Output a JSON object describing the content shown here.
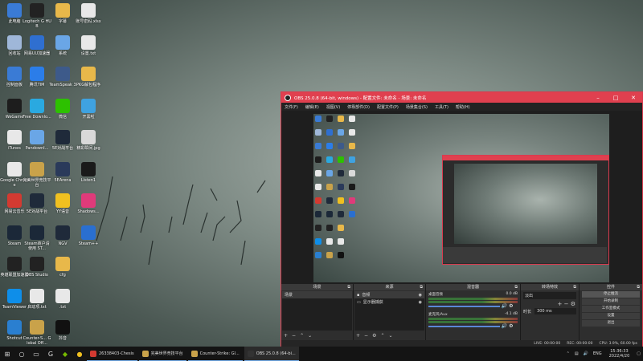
{
  "desktop": {
    "icons": [
      {
        "label": "此电脑",
        "icon": "computer-icon",
        "color": "#3a7bd5",
        "col": 0,
        "row": 0
      },
      {
        "label": "Logitech G HUB",
        "icon": "logitech-icon",
        "color": "#222222",
        "col": 1,
        "row": 0
      },
      {
        "label": "字幕",
        "icon": "folder-icon",
        "color": "#e8b84a",
        "col": 2,
        "row": 0
      },
      {
        "label": "账号密码.xlsx",
        "icon": "excel-icon",
        "color": "#e8e8e8",
        "col": 3,
        "row": 0
      },
      {
        "label": "回收站",
        "icon": "recycle-bin-icon",
        "color": "#9fb7d9",
        "col": 0,
        "row": 1
      },
      {
        "label": "网易UU加速器",
        "icon": "uu-accelerator-icon",
        "color": "#2f6fd0",
        "col": 1,
        "row": 1
      },
      {
        "label": "系统",
        "icon": "folder-icon",
        "color": "#6aa6e6",
        "col": 2,
        "row": 1
      },
      {
        "label": "设置.txt",
        "icon": "text-file-icon",
        "color": "#e8e8e8",
        "col": 3,
        "row": 1
      },
      {
        "label": "控制面板",
        "icon": "control-panel-icon",
        "color": "#3a7bd5",
        "col": 0,
        "row": 2
      },
      {
        "label": "腾讯TIM",
        "icon": "tim-icon",
        "color": "#2b7de9",
        "col": 1,
        "row": 2
      },
      {
        "label": "TeamSpeak 3",
        "icon": "teamspeak-icon",
        "color": "#3d5a8a",
        "col": 2,
        "row": 2
      },
      {
        "label": "PKG解包程序",
        "icon": "folder-icon",
        "color": "#e8b84a",
        "col": 3,
        "row": 2
      },
      {
        "label": "WeGame",
        "icon": "wegame-icon",
        "color": "#1d1d1d",
        "col": 0,
        "row": 3
      },
      {
        "label": "Free Downlo...",
        "icon": "free-download-icon",
        "color": "#2aa9e0",
        "col": 1,
        "row": 3
      },
      {
        "label": "微信",
        "icon": "wechat-icon",
        "color": "#2dc100",
        "col": 2,
        "row": 3
      },
      {
        "label": "开黑啦",
        "icon": "kaiheila-icon",
        "color": "#3fa2e0",
        "col": 3,
        "row": 3
      },
      {
        "label": "iTunes",
        "icon": "itunes-icon",
        "color": "#e8e8e8",
        "col": 0,
        "row": 4
      },
      {
        "label": "PandownI...",
        "icon": "pandown-icon",
        "color": "#6aa6e6",
        "col": 1,
        "row": 4
      },
      {
        "label": "5E对战平台",
        "icon": "5e-platform-icon",
        "color": "#1f2a3a",
        "col": 2,
        "row": 4
      },
      {
        "label": "精彩瞬间.jpg",
        "icon": "image-file-icon",
        "color": "#d9d9d9",
        "col": 3,
        "row": 4
      },
      {
        "label": "Google Chrome",
        "icon": "chrome-icon",
        "color": "#e8e8e8",
        "col": 0,
        "row": 5
      },
      {
        "label": "完美世界竞技平台",
        "icon": "perfect-world-icon",
        "color": "#c9a24a",
        "col": 1,
        "row": 5
      },
      {
        "label": "5EArena",
        "icon": "5earena-icon",
        "color": "#2a3a5a",
        "col": 2,
        "row": 5
      },
      {
        "label": "Listen1",
        "icon": "listen1-icon",
        "color": "#1a1a1a",
        "col": 3,
        "row": 5
      },
      {
        "label": "网易云音乐",
        "icon": "netease-music-icon",
        "color": "#d33a31",
        "col": 0,
        "row": 6
      },
      {
        "label": "5E对战平台",
        "icon": "5e-platform-icon",
        "color": "#1f2a3a",
        "col": 1,
        "row": 6
      },
      {
        "label": "YY语音",
        "icon": "yy-icon",
        "color": "#f0c020",
        "col": 2,
        "row": 6
      },
      {
        "label": "Shadows...",
        "icon": "shadowsocks-icon",
        "color": "#e03a7a",
        "col": 3,
        "row": 6
      },
      {
        "label": "Steam",
        "icon": "steam-icon",
        "color": "#1b2838",
        "col": 0,
        "row": 7
      },
      {
        "label": "Steam商户请使用 ST...",
        "icon": "steam-icon",
        "color": "#1b2838",
        "col": 1,
        "row": 7
      },
      {
        "label": "NGV",
        "icon": "ngv-icon",
        "color": "#1f2a3a",
        "col": 2,
        "row": 7
      },
      {
        "label": "Steam++",
        "icon": "steam-plus-icon",
        "color": "#2a6fd0",
        "col": 3,
        "row": 7
      },
      {
        "label": "英雄联盟加速器",
        "icon": "lol-accelerator-icon",
        "color": "#222222",
        "col": 0,
        "row": 8
      },
      {
        "label": "OBS Studio",
        "icon": "obs-icon",
        "color": "#222222",
        "col": 1,
        "row": 8
      },
      {
        "label": "cfg",
        "icon": "folder-icon",
        "color": "#e8b84a",
        "col": 2,
        "row": 8
      },
      {
        "label": "TeamViewer",
        "icon": "teamviewer-icon",
        "color": "#0e8ee9",
        "col": 0,
        "row": 9
      },
      {
        "label": "启动项.txt",
        "icon": "text-file-icon",
        "color": "#e8e8e8",
        "col": 1,
        "row": 9
      },
      {
        "label": ".txt",
        "icon": "text-file-icon",
        "color": "#e8e8e8",
        "col": 2,
        "row": 9
      },
      {
        "label": "Shotcut",
        "icon": "shotcut-icon",
        "color": "#2a7fd0",
        "col": 0,
        "row": 10
      },
      {
        "label": "Counter-S... Global Off...",
        "icon": "csgo-icon",
        "color": "#c9a24a",
        "col": 1,
        "row": 10
      },
      {
        "label": "抖音",
        "icon": "douyin-icon",
        "color": "#111111",
        "col": 2,
        "row": 10
      }
    ]
  },
  "obs": {
    "title": "OBS 25.0.8 (64-bit, windows) - 配置文件: 未命名 - 场景: 未命名",
    "menu": [
      "文件(F)",
      "编辑(E)",
      "视图(V)",
      "停靠部件(D)",
      "配置文件(P)",
      "场景集合(S)",
      "工具(T)",
      "帮助(H)"
    ],
    "docks": {
      "scenes": {
        "title": "场景",
        "items": [
          "场景"
        ]
      },
      "sources": {
        "title": "来源",
        "items": [
          "音频",
          "显示器捕获"
        ]
      },
      "mixer": {
        "title": "混音器",
        "channels": [
          {
            "name": "桌面音频",
            "db": "0.0 dB"
          },
          {
            "name": "麦克风/Aux",
            "db": "-4.1 dB"
          }
        ]
      },
      "transitions": {
        "title": "转场特效",
        "type": "淡出",
        "duration_label": "时长",
        "duration": "300 ms"
      },
      "controls": {
        "title": "控件",
        "buttons": [
          "停止推流",
          "开始录制",
          "工作室模式",
          "设置",
          "退出"
        ]
      }
    },
    "status": {
      "live": "LIVE: 00:00:00",
      "rec": "REC: 00:00:00",
      "cpu": "CPU: 3.9%, 60.00 fps"
    }
  },
  "taskbar": {
    "apps": [
      {
        "label": "26338403-Chesis",
        "color": "#d33a31",
        "active": false
      },
      {
        "label": "完美世界竞技平台",
        "color": "#c9a24a",
        "active": false
      },
      {
        "label": "Counter-Strike: Gl...",
        "color": "#c9a24a",
        "active": false
      },
      {
        "label": "OBS 25.0.8 (64-bi...",
        "color": "#333333",
        "active": true
      }
    ],
    "lang": "ENG",
    "time": "15:36:33",
    "date": "2022/4/20"
  }
}
